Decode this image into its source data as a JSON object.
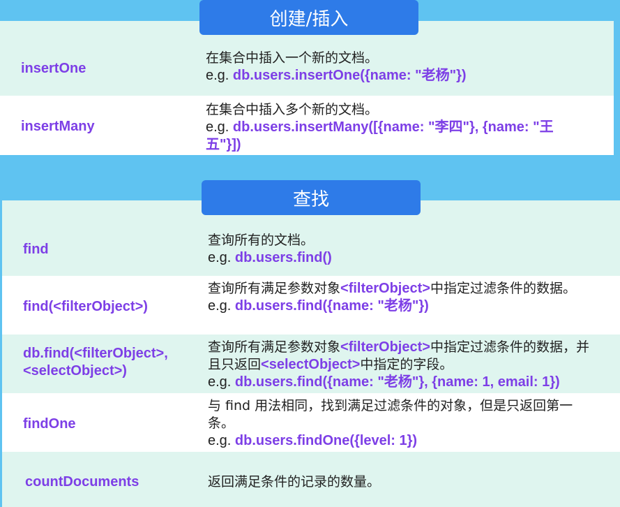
{
  "section_create": {
    "title": "创建/插入",
    "rows": [
      {
        "method": "insertOne",
        "desc": "在集合中插入一个新的文档。",
        "eg": "e.g. ",
        "code": "db.users.insertOne({name: \"老杨\"})"
      },
      {
        "method": "insertMany",
        "desc": "在集合中插入多个新的文档。",
        "eg": "e.g. ",
        "code": "db.users.insertMany([{name: \"李四\"}, {name: \"王五\"}])"
      }
    ]
  },
  "section_find": {
    "title": "查找",
    "rows": [
      {
        "method": "find",
        "desc": "查询所有的文档。",
        "eg": "e.g. ",
        "code": "db.users.find()"
      },
      {
        "method": "find(<filterObject>)",
        "desc_a": "查询所有满足参数对象",
        "desc_code": "<filterObject>",
        "desc_b": "中指定过滤条件的数据。",
        "eg": "e.g. ",
        "code": "db.users.find({name: \"老杨\"})"
      },
      {
        "method_line1": "db.find(<filterObject>,",
        "method_line2": "<selectObject>)",
        "desc_a": "查询所有满足参数对象",
        "desc_code": "<filterObject>",
        "desc_b": "中指定过滤条件的数据，并且只返回",
        "desc_code2": "<selectObject>",
        "desc_c": "中指定的字段。",
        "eg": "e.g. ",
        "code": "db.users.find({name: \"老杨\"}, {name: 1, email: 1})"
      },
      {
        "method": "findOne",
        "desc": "与 find 用法相同，找到满足过滤条件的对象，但是只返回第一条。",
        "eg": "e.g. ",
        "code": "db.users.findOne({level: 1})"
      },
      {
        "method": "countDocuments",
        "desc": "返回满足条件的记录的数量。"
      }
    ]
  }
}
